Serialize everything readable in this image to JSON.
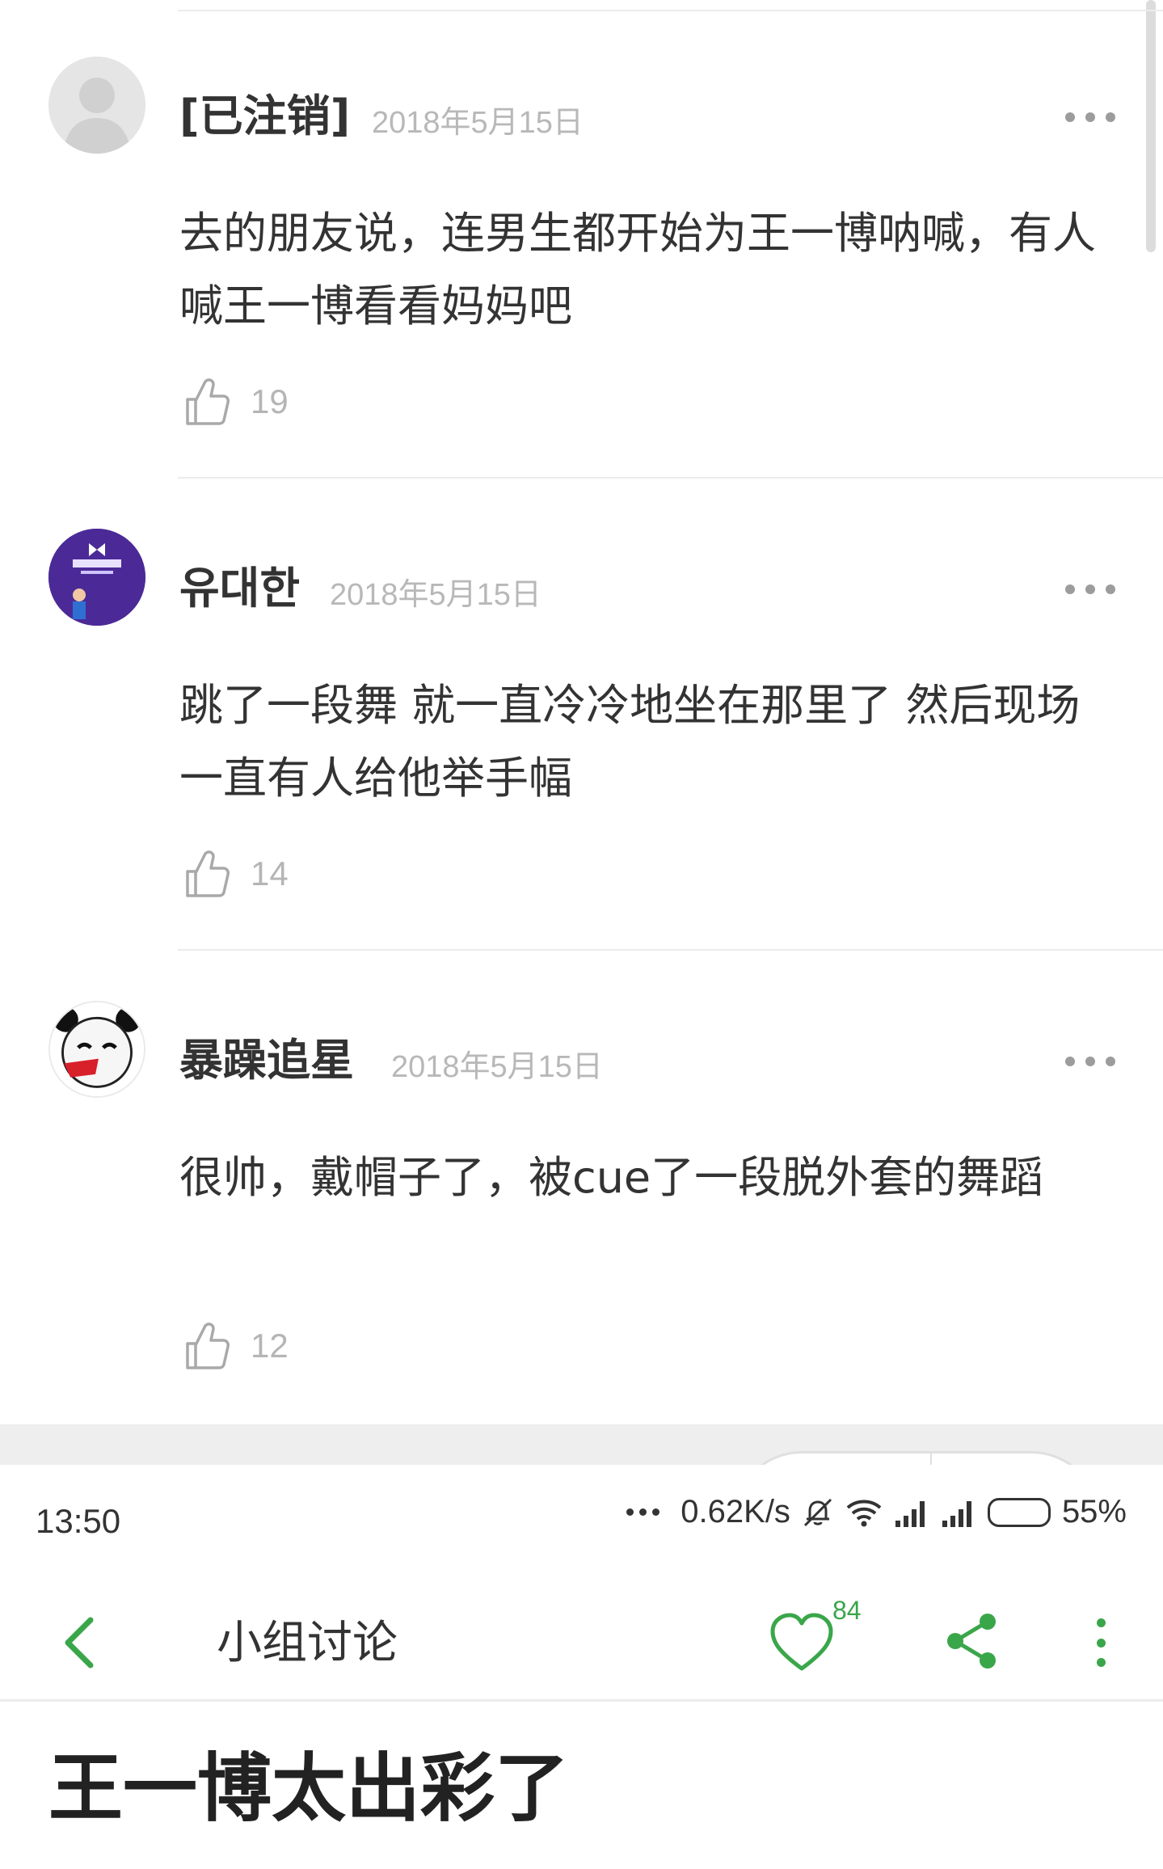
{
  "comments": [
    {
      "username": "[已注销]",
      "date": "2018年5月15日",
      "text": "去的朋友说，连男生都开始为王一博呐喊，有人喊王一博看看妈妈吧",
      "likes": "19",
      "avatar": "default-avatar"
    },
    {
      "username": "유대한",
      "date": "2018年5月15日",
      "text": "跳了一段舞 就一直冷冷地坐在那里了 然后现场一直有人给他举手幅",
      "likes": "14",
      "avatar": "purple-avatar"
    },
    {
      "username": "暴躁追星",
      "date": "2018年5月15日",
      "text": "很帅，戴帽子了，被cue了一段脱外套的舞蹈",
      "likes": "12",
      "avatar": "panda-avatar"
    }
  ],
  "status_bar": {
    "time": "13:50",
    "speed": "0.62K/s",
    "battery": "55%",
    "battery_level": 0.55
  },
  "app_bar": {
    "title": "小组讨论",
    "favorite_count": "84"
  },
  "group": {
    "title": "王一博太出彩了"
  },
  "colors": {
    "accent": "#3aa64a",
    "text": "#333333",
    "muted": "#b8b8b8",
    "divider": "#ececec"
  }
}
